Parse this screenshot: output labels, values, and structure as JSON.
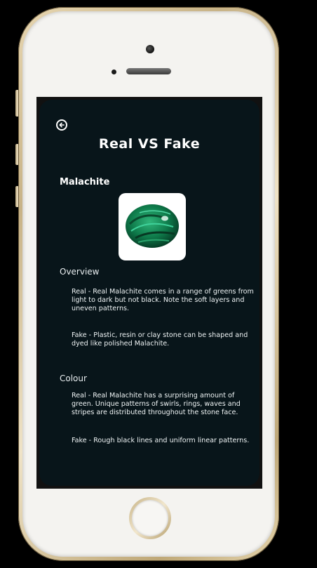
{
  "screen": {
    "title": "Real VS Fake",
    "stone_name": "Malachite",
    "back_icon": "arrow-left-circle-icon",
    "sections": [
      {
        "heading": "Overview",
        "items": [
          "Real - Real Malachite comes in a range of greens from light to dark but not black. Note the soft layers and uneven patterns.",
          "Fake - Plastic, resin or clay stone can be shaped and dyed like polished Malachite."
        ]
      },
      {
        "heading": "Colour",
        "items": [
          "Real - Real Malachite has a surprising amount of green. Unique patterns of swirls, rings, waves and stripes are distributed throughout the stone face.",
          "Fake - Rough black lines and uniform linear patterns."
        ]
      }
    ]
  },
  "colors": {
    "screen_background": "#08151a",
    "text": "#ffffff",
    "phone_frame": "#c8b387",
    "stone_green": "#0e7a4a"
  }
}
